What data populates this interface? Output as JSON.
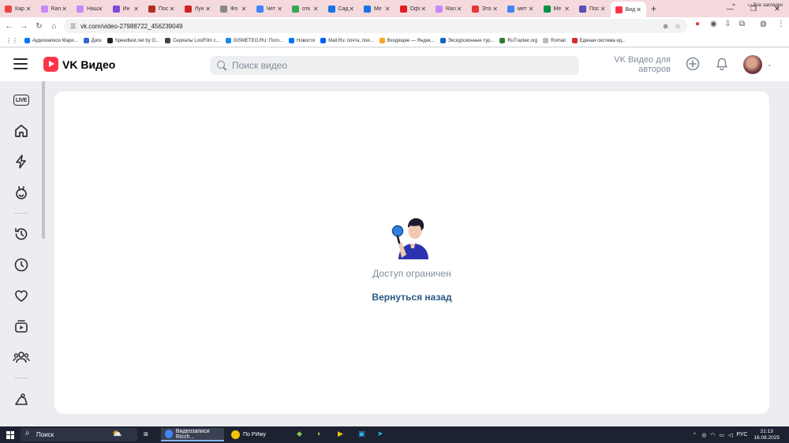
{
  "browser": {
    "tabs": [
      {
        "label": "Кар",
        "color": "#e8453c"
      },
      {
        "label": "Ran",
        "color": "#c58af9"
      },
      {
        "label": "Наш",
        "color": "#c58af9"
      },
      {
        "label": "Ин",
        "color": "#7b4cd8"
      },
      {
        "label": "Пос",
        "color": "#b0301f"
      },
      {
        "label": "Лун",
        "color": "#cc2222"
      },
      {
        "label": "Фо",
        "color": "#888888"
      },
      {
        "label": "Чет",
        "color": "#4285f4"
      },
      {
        "label": "отк",
        "color": "#34a853"
      },
      {
        "label": "Сад",
        "color": "#1a73e8"
      },
      {
        "label": "Ме",
        "color": "#1a73e8"
      },
      {
        "label": "Офі",
        "color": "#e02020"
      },
      {
        "label": "Ran",
        "color": "#c58af9"
      },
      {
        "label": "Это",
        "color": "#e53935"
      },
      {
        "label": "мет",
        "color": "#4285f4"
      },
      {
        "label": "Ме",
        "color": "#009246"
      },
      {
        "label": "Пос",
        "color": "#5a4fb5"
      },
      {
        "label": "Вид",
        "color": "#ff3347",
        "active": true
      }
    ],
    "url": "vk.com/video-27988722_456239049",
    "bookmarks": [
      {
        "label": "Аудиозаписи Мари...",
        "color": "#0077ff"
      },
      {
        "label": "Диск",
        "color": "#3366cc"
      },
      {
        "label": "Speedtest.net by O...",
        "color": "#222222"
      },
      {
        "label": "Сериалы LostFilm с...",
        "color": "#444444"
      },
      {
        "label": "GISMETEO.RU: Пого...",
        "color": "#1e88e5"
      },
      {
        "label": "Новости",
        "color": "#0077ff"
      },
      {
        "label": "Mail.Ru: почта, пои...",
        "color": "#005ff9"
      },
      {
        "label": "Входящие — Яндек...",
        "color": "#f5a623"
      },
      {
        "label": "Экскурсионные тур...",
        "color": "#1565c0"
      },
      {
        "label": "RuTracker.org",
        "color": "#2e7d32"
      },
      {
        "label": "Roman",
        "color": "#b0bec5"
      },
      {
        "label": "Единая система ид...",
        "color": "#d32f2f"
      }
    ],
    "all_bookmarks": "Все закладки"
  },
  "header": {
    "logo_text": "VK Видео",
    "search_placeholder": "Поиск видео",
    "authors_label": "VK Видео для авторов"
  },
  "content": {
    "message": "Доступ ограничен",
    "back_link": "Вернуться назад"
  },
  "taskbar": {
    "search_label": "Поиск",
    "apps": [
      {
        "label": "Видеозаписи Ricch...",
        "color": "#4285f4",
        "active": true
      },
      {
        "label": "По РИму",
        "color": "#f4c20d",
        "active": false
      }
    ],
    "lang": "РУС",
    "time": "21:13",
    "date": "16.08.2025"
  }
}
